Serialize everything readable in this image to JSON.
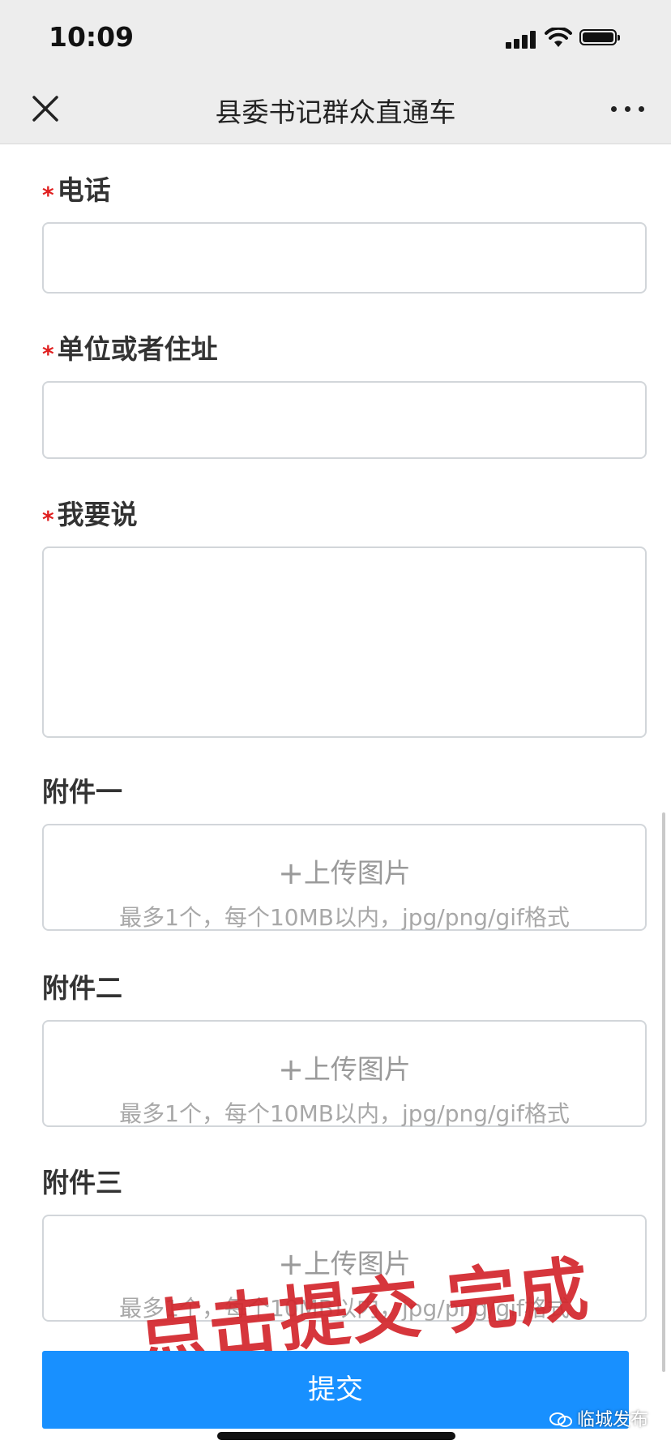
{
  "status_bar": {
    "time": "10:09"
  },
  "nav": {
    "title": "县委书记群众直通车"
  },
  "form": {
    "phone_label": "电话",
    "address_label": "单位或者住址",
    "message_label": "我要说",
    "required_mark": "*",
    "attachments": [
      {
        "label": "附件一",
        "upload_text": "上传图片",
        "hint": "最多1个，每个10MB以内，jpg/png/gif格式"
      },
      {
        "label": "附件二",
        "upload_text": "上传图片",
        "hint": "最多1个，每个10MB以内，jpg/png/gif格式"
      },
      {
        "label": "附件三",
        "upload_text": "上传图片",
        "hint": "最多1个，每个10MB以内，jpg/png/gif格式"
      }
    ],
    "plus_symbol": "+"
  },
  "submit": {
    "label": "提交"
  },
  "annotation": {
    "text": "点击提交  完成"
  },
  "watermark": {
    "text": "临城发布"
  },
  "colors": {
    "accent": "#1890ff",
    "required": "#e02020",
    "annotation": "#d3262c"
  }
}
